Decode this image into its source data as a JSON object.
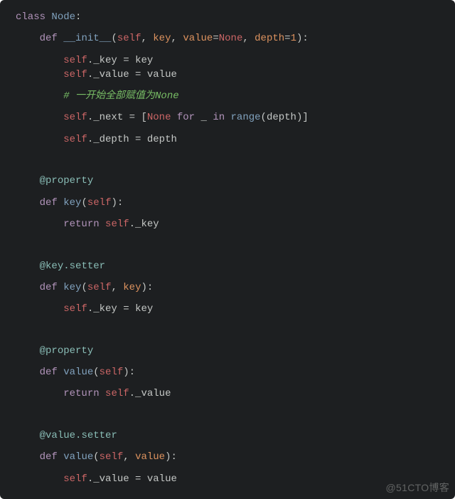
{
  "watermark": "@51CTO博客",
  "code": {
    "l1": {
      "kw_class": "class",
      "name": "Node",
      "colon": ":"
    },
    "l2": {
      "kw_def": "def",
      "name": "__init__",
      "lp": "(",
      "self": "self",
      "c1": ", ",
      "p1": "key",
      "c2": ", ",
      "p2": "value",
      "eq1": "=",
      "none1": "None",
      "c3": ", ",
      "p3": "depth",
      "eq2": "=",
      "num": "1",
      "rp": ")",
      "colon": ":"
    },
    "l3": {
      "self": "self",
      "dot": "._key ",
      "op": "= ",
      "p": "key"
    },
    "l4": {
      "self": "self",
      "dot": "._value ",
      "op": "= ",
      "p": "value"
    },
    "l5": {
      "comment": "# 一开始全部赋值为None"
    },
    "l6": {
      "self": "self",
      "dot": "._next ",
      "op": "= ",
      "lb": "[",
      "none": "None",
      "sp1": " ",
      "for": "for",
      "sp2": " ",
      "us": "_",
      "sp3": " ",
      "in": "in",
      "sp4": " ",
      "range": "range",
      "lp": "(",
      "p": "depth",
      "rp": ")",
      "rb": "]"
    },
    "l7": {
      "self": "self",
      "dot": "._depth ",
      "op": "= ",
      "p": "depth"
    },
    "d1": {
      "at": "@",
      "name": "property"
    },
    "l8": {
      "kw_def": "def",
      "name": "key",
      "lp": "(",
      "self": "self",
      "rp": ")",
      "colon": ":"
    },
    "l9": {
      "kw": "return",
      "sp": " ",
      "self": "self",
      "tail": "._key"
    },
    "d2": {
      "at": "@",
      "qual": "key",
      "dot": ".",
      "name": "setter"
    },
    "l10": {
      "kw_def": "def",
      "name": "key",
      "lp": "(",
      "self": "self",
      "c1": ", ",
      "p1": "key",
      "rp": ")",
      "colon": ":"
    },
    "l11": {
      "self": "self",
      "dot": "._key ",
      "op": "= ",
      "p": "key"
    },
    "d3": {
      "at": "@",
      "name": "property"
    },
    "l12": {
      "kw_def": "def",
      "name": "value",
      "lp": "(",
      "self": "self",
      "rp": ")",
      "colon": ":"
    },
    "l13": {
      "kw": "return",
      "sp": " ",
      "self": "self",
      "tail": "._value"
    },
    "d4": {
      "at": "@",
      "qual": "value",
      "dot": ".",
      "name": "setter"
    },
    "l14": {
      "kw_def": "def",
      "name": "value",
      "lp": "(",
      "self": "self",
      "c1": ", ",
      "p1": "value",
      "rp": ")",
      "colon": ":"
    },
    "l15": {
      "self": "self",
      "dot": "._value ",
      "op": "= ",
      "p": "value"
    }
  }
}
